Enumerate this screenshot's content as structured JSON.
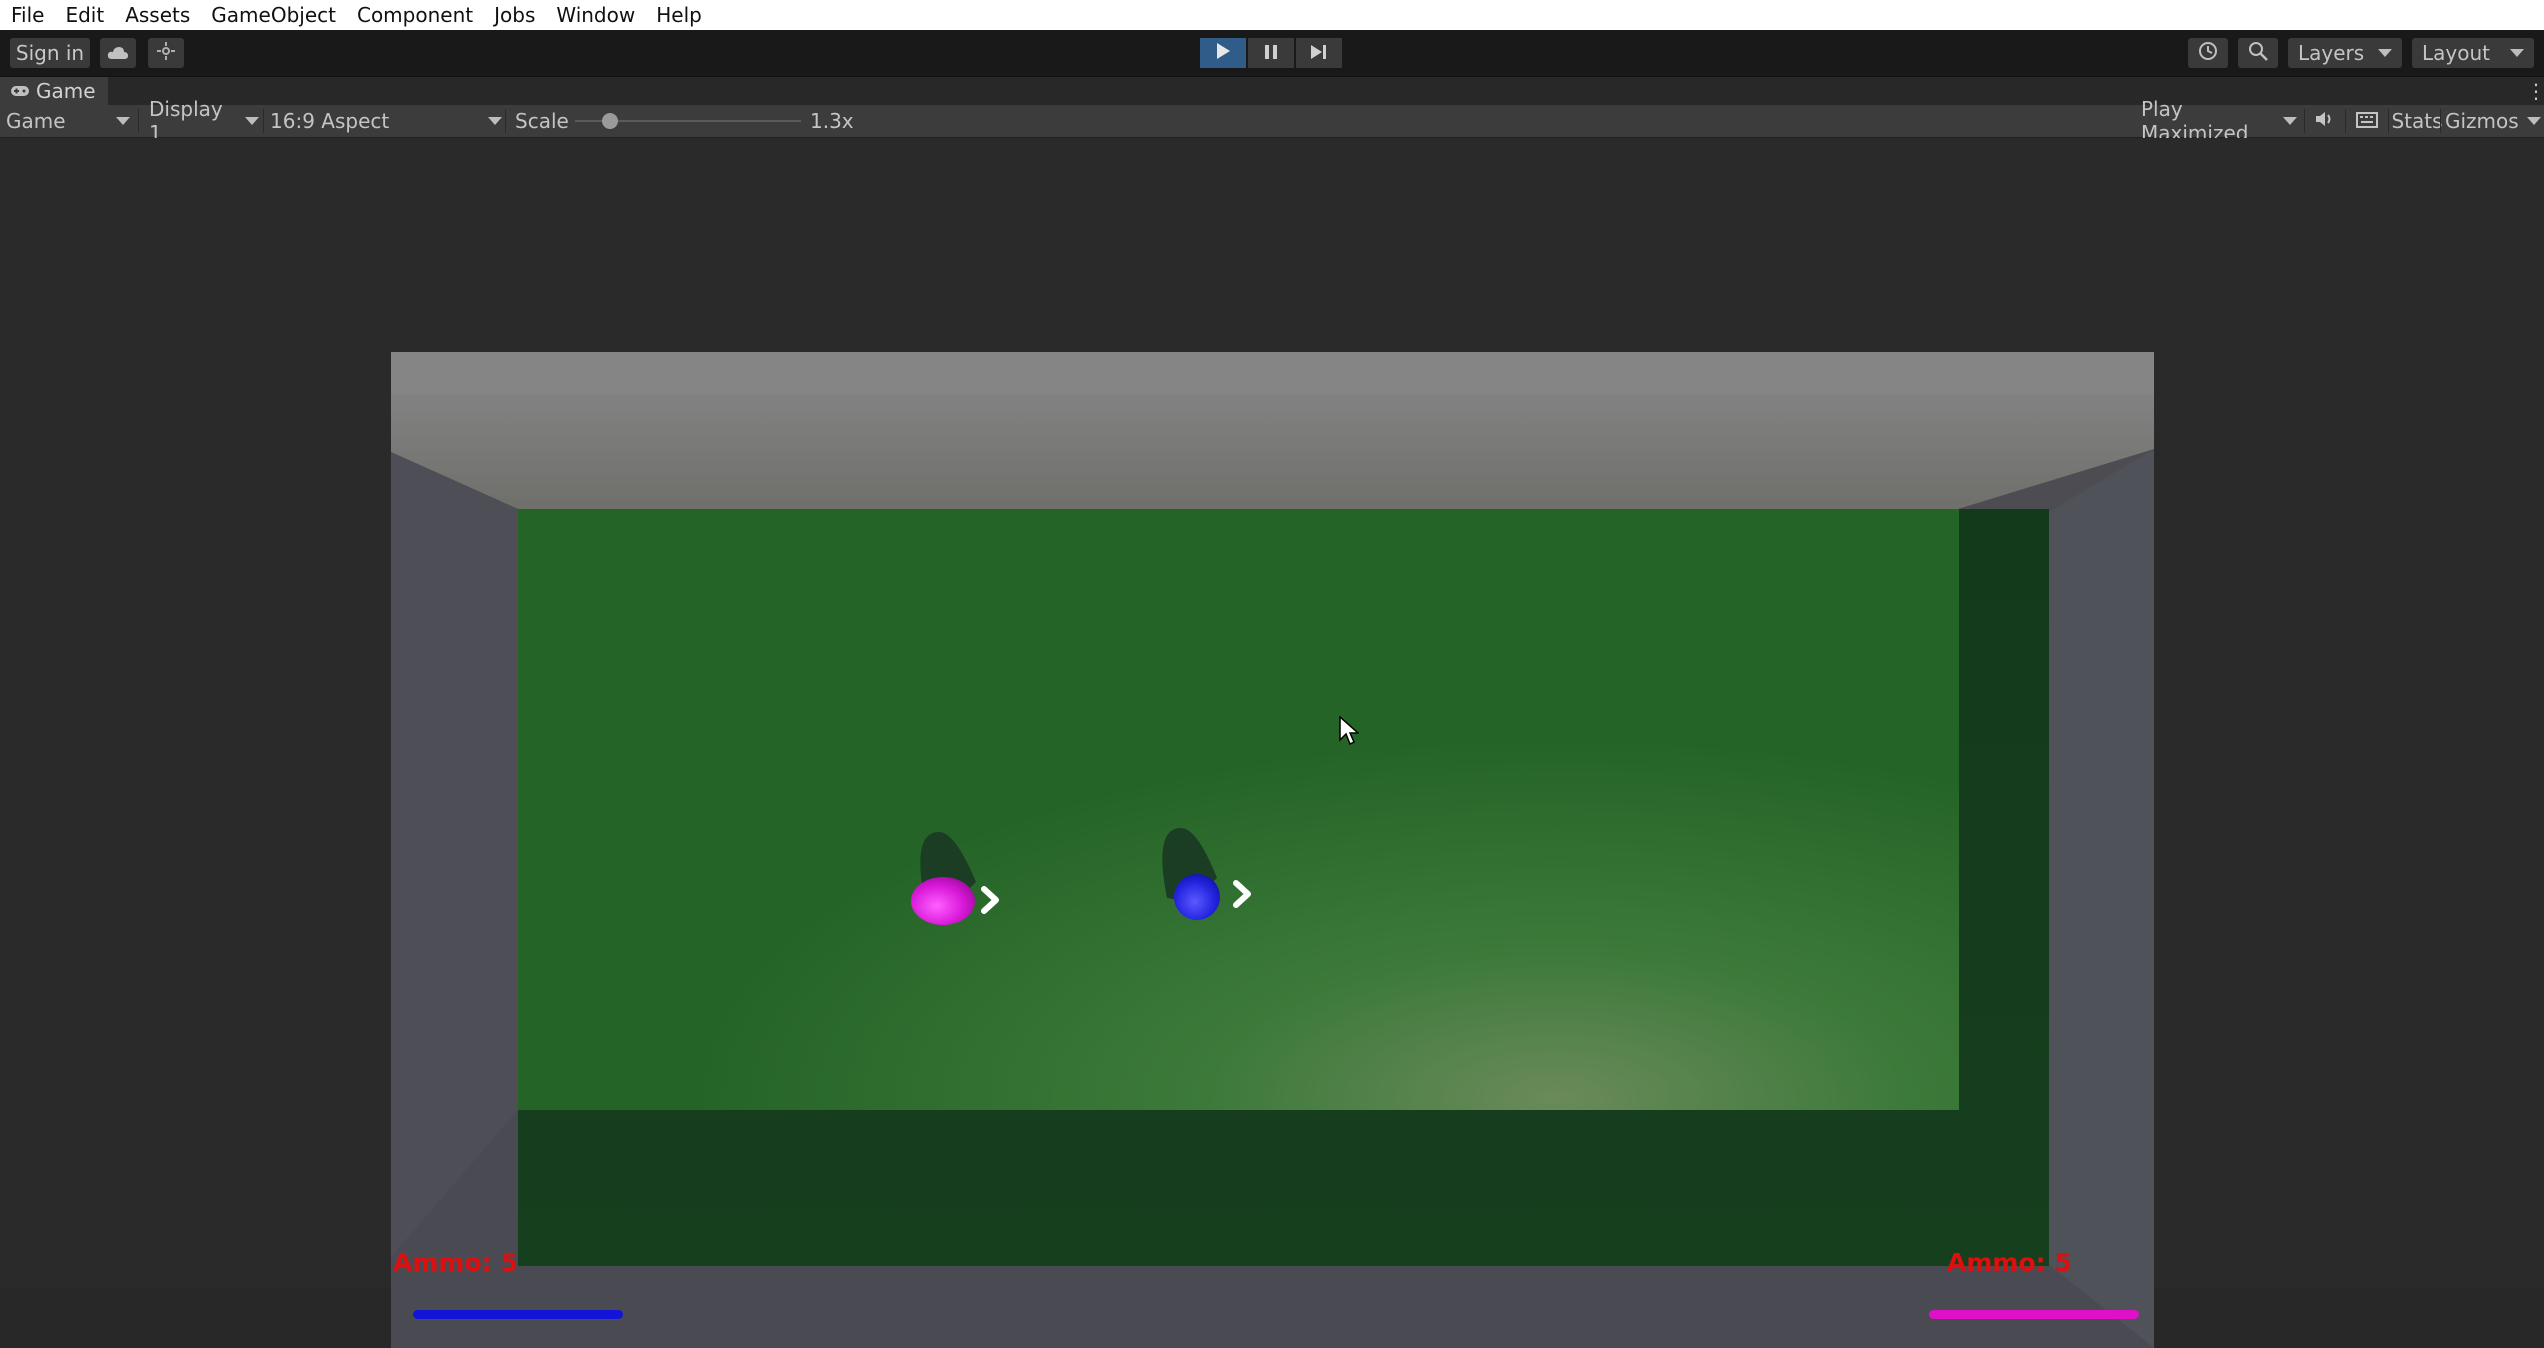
{
  "menu": [
    "File",
    "Edit",
    "Assets",
    "GameObject",
    "Component",
    "Jobs",
    "Window",
    "Help"
  ],
  "toolbar": {
    "sign_in": "Sign in",
    "cloud_icon": "cloud-icon",
    "collab_icon": "collab-icon",
    "play_icon": "play-icon",
    "pause_icon": "pause-icon",
    "step_icon": "step-icon",
    "history_icon": "history-icon",
    "search_icon": "search-icon",
    "layers": "Layers",
    "layout": "Layout"
  },
  "tab": {
    "label": "Game",
    "icon": "gamepad-icon"
  },
  "gamebar": {
    "view": "Game",
    "display": "Display 1",
    "aspect": "16:9 Aspect",
    "scale_label": "Scale",
    "scale_value": "1.3x",
    "scale_fraction": 0.13,
    "play_mode": "Play Maximized",
    "audio_icon": "speaker-icon",
    "keyboard_icon": "keyboard-icon",
    "stats": "Stats",
    "gizmos": "Gizmos"
  },
  "game": {
    "left_ammo": "Ammo: 5",
    "right_ammo": "Ammo: 5",
    "left_bar_color": "#1414d8",
    "right_bar_color": "#e010c8",
    "player1_color": "#e020e0",
    "player2_color": "#2a2ae0",
    "floor_color": "#2a6b2d"
  }
}
